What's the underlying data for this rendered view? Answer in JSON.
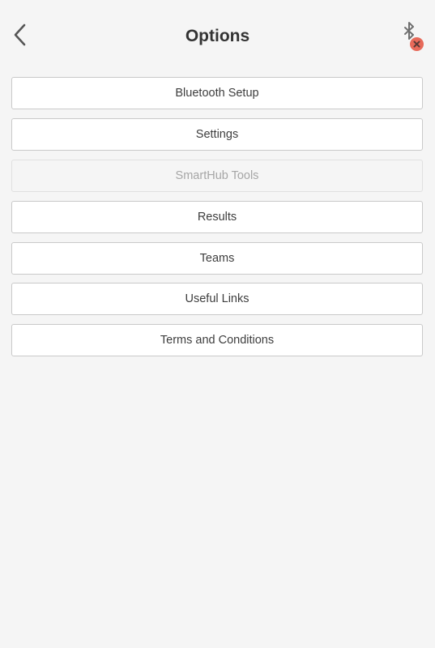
{
  "header": {
    "title": "Options",
    "back_icon": "chevron-left-icon",
    "bluetooth_icon": "bluetooth-icon",
    "bluetooth_status_icon": "close-icon",
    "bluetooth_status_color": "#e76a5a"
  },
  "menu": {
    "items": [
      {
        "label": "Bluetooth Setup",
        "enabled": true
      },
      {
        "label": "Settings",
        "enabled": true
      },
      {
        "label": "SmartHub Tools",
        "enabled": false
      },
      {
        "label": "Results",
        "enabled": true
      },
      {
        "label": "Teams",
        "enabled": true
      },
      {
        "label": "Useful Links",
        "enabled": true
      },
      {
        "label": "Terms and Conditions",
        "enabled": true
      }
    ]
  }
}
